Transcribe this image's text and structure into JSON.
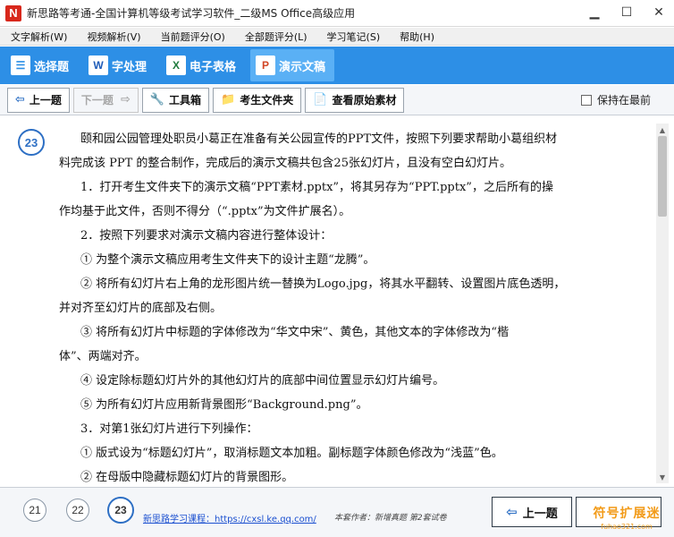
{
  "window": {
    "title": "新思路等考通-全国计算机等级考试学习软件_二级MS Office高级应用",
    "app_icon": "N",
    "minimize": "▁",
    "maximize": "☐",
    "close": "✕"
  },
  "menu": [
    "文字解析(W)",
    "视频解析(V)",
    "当前题评分(O)",
    "全部题评分(L)",
    "学习笔记(S)",
    "帮助(H)"
  ],
  "modules": [
    {
      "label": "选择题",
      "icon": "☰",
      "active": false
    },
    {
      "label": "字处理",
      "icon": "W",
      "active": false
    },
    {
      "label": "电子表格",
      "icon": "X",
      "active": false
    },
    {
      "label": "演示文稿",
      "icon": "P",
      "active": true
    }
  ],
  "toolbar": {
    "prev": "上一题",
    "next": "下一题",
    "tools": "工具箱",
    "student_folder": "考生文件夹",
    "view_source": "查看原始素材",
    "keep_on_top": "保持在最前"
  },
  "question": {
    "number": "23",
    "lines": [
      "颐和园公园管理处职员小葛正在准备有关公园宣传的PPT文件，按照下列要求帮助小葛组织材",
      "料完成该 PPT 的整合制作，完成后的演示文稿共包含25张幻灯片，且没有空白幻灯片。",
      "1．打开考生文件夹下的演示文稿“PPT素材.pptx”，将其另存为“PPT.pptx”，之后所有的操",
      "作均基于此文件，否则不得分（“.pptx”为文件扩展名）。",
      "2．按照下列要求对演示文稿内容进行整体设计：",
      "① 为整个演示文稿应用考生文件夹下的设计主题“龙腾”。",
      "② 将所有幻灯片右上角的龙形图片统一替换为Logo.jpg，将其水平翻转、设置图片底色透明，",
      "并对齐至幻灯片的底部及右侧。",
      "③ 将所有幻灯片中标题的字体修改为“华文中宋”、黄色，其他文本的字体修改为“楷",
      "体”、两端对齐。",
      "④ 设定除标题幻灯片外的其他幻灯片的底部中间位置显示幻灯片编号。",
      "⑤ 为所有幻灯片应用新背景图形“Background.png”。",
      "3．对第1张幻灯片进行下列操作：",
      "① 版式设为“标题幻灯片”，取消标题文本加粗。副标题字体颜色修改为“浅蓝”色。",
      "② 在母版中隐藏标题幻灯片的背景图形。"
    ]
  },
  "footer": {
    "questions": [
      "21",
      "22",
      "23"
    ],
    "course_link": "新思路学习课程：https://cxsl.ke.qq.com/",
    "author_note": "本套作者：新增真题  第2套试卷",
    "prev": "上一题",
    "watermark": "符号扩展迷",
    "watermark_url": "fuhao321.com"
  },
  "colors": {
    "module_band": "#2d8fe6",
    "accent": "#2d6fc4",
    "close_red": "#d8281c",
    "watermark": "#f29b19"
  }
}
